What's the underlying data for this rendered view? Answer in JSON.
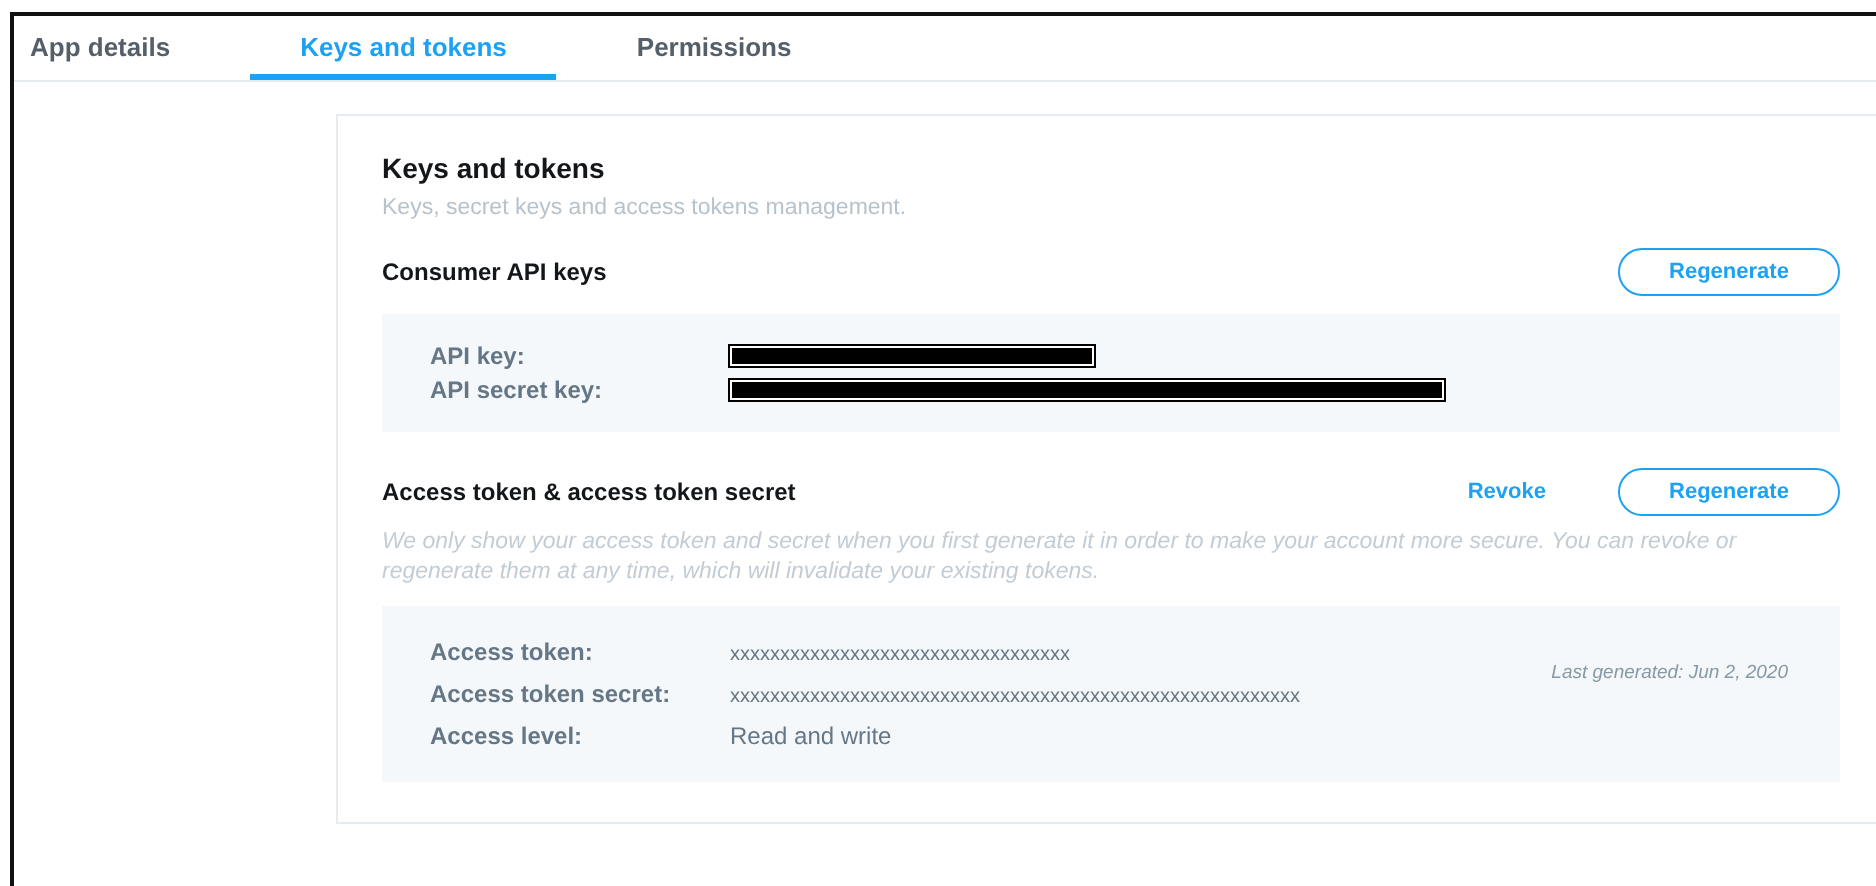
{
  "tabs": [
    {
      "label": "App details",
      "selected": false
    },
    {
      "label": "Keys and tokens",
      "selected": true
    },
    {
      "label": "Permissions",
      "selected": false
    }
  ],
  "card": {
    "title": "Keys and tokens",
    "subtitle": "Keys, secret keys and access tokens management.",
    "sections": [
      {
        "heading": "Consumer API keys",
        "actions": [
          {
            "kind": "outline",
            "label": "Regenerate"
          }
        ],
        "fields": [
          {
            "label": "API key:",
            "kind": "redacted"
          },
          {
            "label": "API secret key:",
            "kind": "redacted"
          }
        ]
      },
      {
        "heading": "Access token & access token secret",
        "actions": [
          {
            "kind": "link",
            "label": "Revoke"
          },
          {
            "kind": "outline",
            "label": "Regenerate"
          }
        ],
        "description": "We only show your access token and secret when you first generate it in order to make your account more secure. You can revoke or regenerate them at any time, which will invalidate your existing tokens.",
        "fields": [
          {
            "label": "Access token:",
            "kind": "text",
            "value": "xxxxxxxxxxxxxxxxxxxxxxxxxxxxxxxxxx"
          },
          {
            "label": "Access token secret:",
            "kind": "text",
            "value": "xxxxxxxxxxxxxxxxxxxxxxxxxxxxxxxxxxxxxxxxxxxxxxxxxxxxxxxxx"
          },
          {
            "label": "Access level:",
            "kind": "plain",
            "value": "Read and write"
          }
        ],
        "note": "Last generated: Jun 2, 2020"
      }
    ]
  }
}
